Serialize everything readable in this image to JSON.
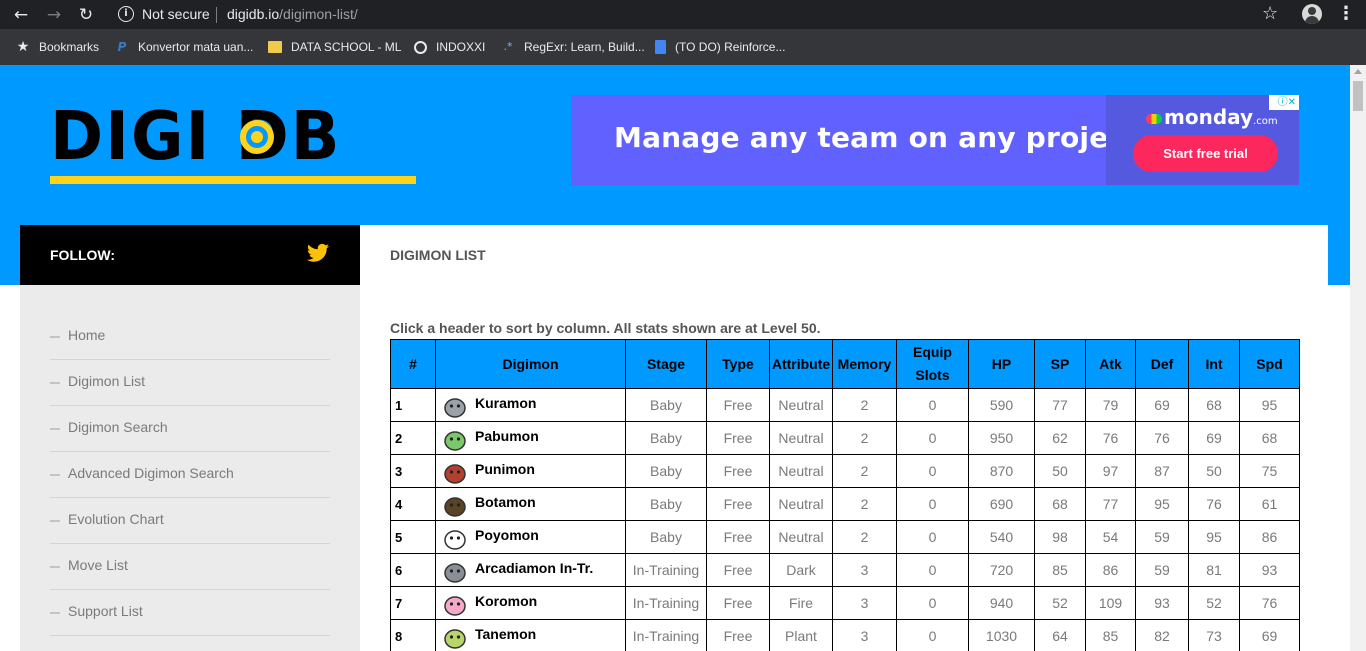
{
  "browser": {
    "security_label": "Not secure",
    "url_host": "digidb.io",
    "url_path": "/digimon-list/",
    "bookmarks": [
      {
        "label": "Bookmarks",
        "icon": "star-icon"
      },
      {
        "label": "Konvertor mata uan...",
        "icon": "paypal-icon"
      },
      {
        "label": "DATA SCHOOL - ML",
        "icon": "folder-icon"
      },
      {
        "label": "INDOXXI",
        "icon": "globe-icon"
      },
      {
        "label": "RegExr: Learn, Build...",
        "icon": "regexr-icon"
      },
      {
        "label": "(TO DO) Reinforce...",
        "icon": "document-icon"
      }
    ]
  },
  "site": {
    "logo_text": "DIGI DB",
    "colors": {
      "brand_blue": "#0099ff",
      "brand_yellow": "#ffd31a",
      "sidebar_bg": "#ebebeb"
    }
  },
  "ad": {
    "headline": "Manage any team on any project",
    "brand": "monday",
    "brand_suffix": ".com",
    "cta": "Start free trial",
    "badge": "ⓘ✕"
  },
  "follow": {
    "label": "FOLLOW:",
    "icon": "twitter-icon"
  },
  "sidebar": {
    "items": [
      {
        "label": "Home"
      },
      {
        "label": "Digimon List"
      },
      {
        "label": "Digimon Search"
      },
      {
        "label": "Advanced Digimon Search"
      },
      {
        "label": "Evolution Chart"
      },
      {
        "label": "Move List"
      },
      {
        "label": "Support List"
      }
    ]
  },
  "main": {
    "title": "DIGIMON LIST",
    "caption": "Click a header to sort by column. All stats shown are at Level 50.",
    "table": {
      "headers": [
        "#",
        "Digimon",
        "Stage",
        "Type",
        "Attribute",
        "Memory",
        "Equip Slots",
        "HP",
        "SP",
        "Atk",
        "Def",
        "Int",
        "Spd"
      ],
      "rows": [
        {
          "num": "1",
          "name": "Kuramon",
          "stage": "Baby",
          "type": "Free",
          "attribute": "Neutral",
          "memory": "2",
          "equip": "0",
          "hp": "590",
          "sp": "77",
          "atk": "79",
          "def": "69",
          "int": "68",
          "spd": "95"
        },
        {
          "num": "2",
          "name": "Pabumon",
          "stage": "Baby",
          "type": "Free",
          "attribute": "Neutral",
          "memory": "2",
          "equip": "0",
          "hp": "950",
          "sp": "62",
          "atk": "76",
          "def": "76",
          "int": "69",
          "spd": "68"
        },
        {
          "num": "3",
          "name": "Punimon",
          "stage": "Baby",
          "type": "Free",
          "attribute": "Neutral",
          "memory": "2",
          "equip": "0",
          "hp": "870",
          "sp": "50",
          "atk": "97",
          "def": "87",
          "int": "50",
          "spd": "75"
        },
        {
          "num": "4",
          "name": "Botamon",
          "stage": "Baby",
          "type": "Free",
          "attribute": "Neutral",
          "memory": "2",
          "equip": "0",
          "hp": "690",
          "sp": "68",
          "atk": "77",
          "def": "95",
          "int": "76",
          "spd": "61"
        },
        {
          "num": "5",
          "name": "Poyomon",
          "stage": "Baby",
          "type": "Free",
          "attribute": "Neutral",
          "memory": "2",
          "equip": "0",
          "hp": "540",
          "sp": "98",
          "atk": "54",
          "def": "59",
          "int": "95",
          "spd": "86"
        },
        {
          "num": "6",
          "name": "Arcadiamon In-Tr.",
          "stage": "In-Training",
          "type": "Free",
          "attribute": "Dark",
          "memory": "3",
          "equip": "0",
          "hp": "720",
          "sp": "85",
          "atk": "86",
          "def": "59",
          "int": "81",
          "spd": "93"
        },
        {
          "num": "7",
          "name": "Koromon",
          "stage": "In-Training",
          "type": "Free",
          "attribute": "Fire",
          "memory": "3",
          "equip": "0",
          "hp": "940",
          "sp": "52",
          "atk": "109",
          "def": "93",
          "int": "52",
          "spd": "76"
        },
        {
          "num": "8",
          "name": "Tanemon",
          "stage": "In-Training",
          "type": "Free",
          "attribute": "Plant",
          "memory": "3",
          "equip": "0",
          "hp": "1030",
          "sp": "64",
          "atk": "85",
          "def": "82",
          "int": "73",
          "spd": "69"
        }
      ]
    }
  }
}
